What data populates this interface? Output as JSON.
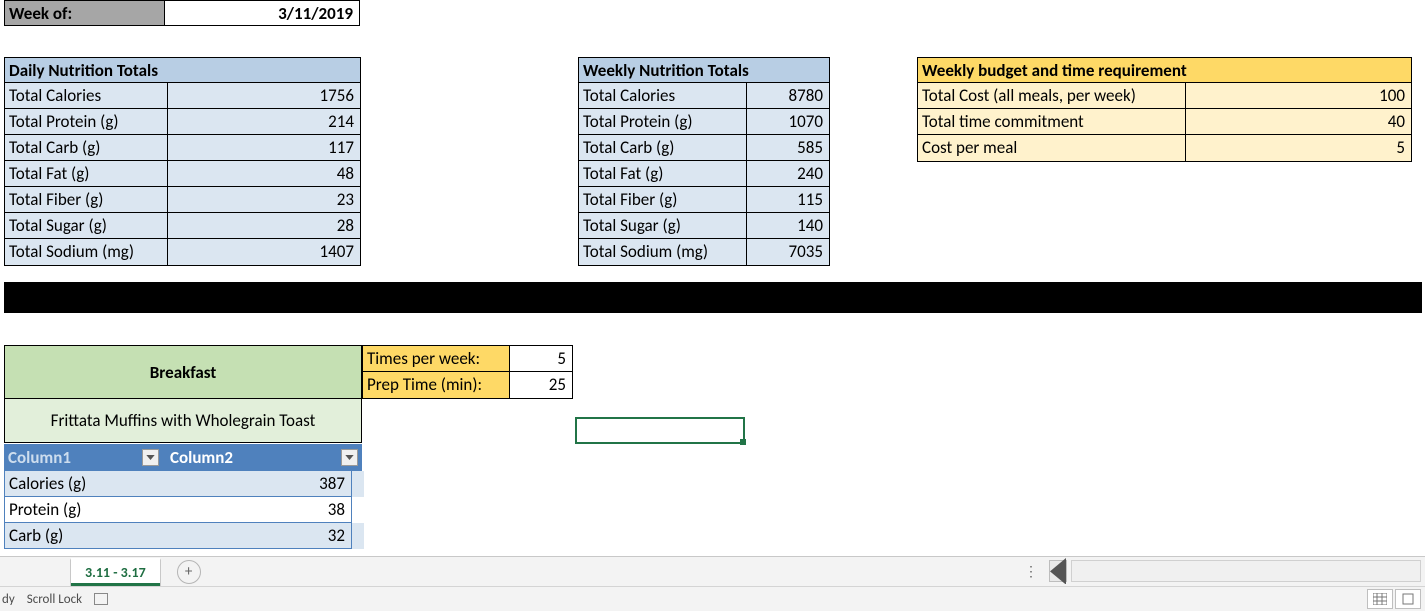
{
  "week_of": {
    "label": "Week of:",
    "date": "3/11/2019"
  },
  "daily": {
    "header": "Daily Nutrition Totals",
    "rows": [
      {
        "label": "Total Calories",
        "value": "1756"
      },
      {
        "label": "Total Protein (g)",
        "value": "214"
      },
      {
        "label": "Total Carb (g)",
        "value": "117"
      },
      {
        "label": "Total Fat (g)",
        "value": "48"
      },
      {
        "label": "Total Fiber (g)",
        "value": "23"
      },
      {
        "label": "Total Sugar (g)",
        "value": "28"
      },
      {
        "label": "Total Sodium (mg)",
        "value": "1407"
      }
    ]
  },
  "weekly": {
    "header": "Weekly Nutrition Totals",
    "rows": [
      {
        "label": "Total Calories",
        "value": "8780"
      },
      {
        "label": "Total Protein (g)",
        "value": "1070"
      },
      {
        "label": "Total Carb (g)",
        "value": "585"
      },
      {
        "label": "Total Fat (g)",
        "value": "240"
      },
      {
        "label": "Total Fiber (g)",
        "value": "115"
      },
      {
        "label": "Total Sugar (g)",
        "value": "140"
      },
      {
        "label": "Total Sodium (mg)",
        "value": "7035"
      }
    ]
  },
  "budget": {
    "header": "Weekly budget and time requirement",
    "rows": [
      {
        "label": "Total Cost (all meals, per week)",
        "value": "100"
      },
      {
        "label": "Total time commitment",
        "value": "40"
      },
      {
        "label": "Cost per meal",
        "value": "5"
      }
    ]
  },
  "breakfast_label": "Breakfast",
  "times": {
    "rows": [
      {
        "label": "Times per week:",
        "value": "5"
      },
      {
        "label": "Prep Time (min):",
        "value": "25"
      }
    ]
  },
  "meal_name": "Frittata Muffins with Wholegrain Toast",
  "mini": {
    "col1": "Column1",
    "col2": "Column2",
    "rows": [
      {
        "label": "Calories (g)",
        "value": "387"
      },
      {
        "label": "Protein (g)",
        "value": "38"
      },
      {
        "label": "Carb (g)",
        "value": "32"
      }
    ]
  },
  "tab_name": "3.11 - 3.17",
  "status": {
    "ready": "dy",
    "scroll": "Scroll Lock"
  }
}
